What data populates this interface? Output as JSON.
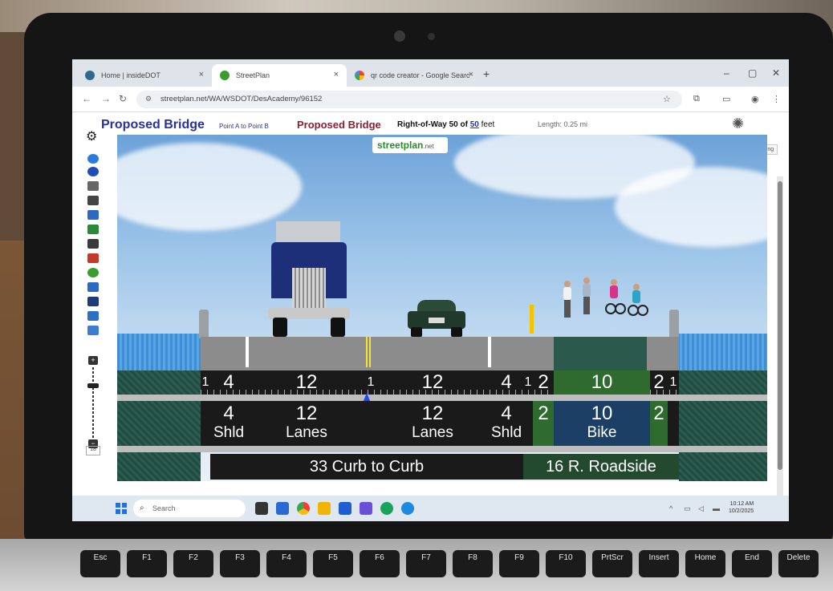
{
  "browser": {
    "tabs": [
      {
        "label": "Home | insideDOT"
      },
      {
        "label": "StreetPlan"
      },
      {
        "label": "qr code creator - Google Searc"
      }
    ],
    "url": "streetplan.net/WA/WSDOT/DesAcademy/96152"
  },
  "header": {
    "title": "Proposed Bridge",
    "subtitle": "Point A to Point B",
    "title2": "Proposed Bridge",
    "row_label": "Right-of-Way 50 of",
    "row_link": "50",
    "row_unit": "feet",
    "length": "Length: 0.25 mi",
    "tooltip": "Right Building"
  },
  "logo": {
    "main": "streetplan",
    "suffix": ".net"
  },
  "zoom": {
    "level": "18"
  },
  "widths": [
    "1",
    "4",
    "12",
    "1",
    "12",
    "4",
    "1",
    "2",
    "10",
    "2",
    "1"
  ],
  "labels": [
    {
      "n": "4",
      "t": "Shld"
    },
    {
      "n": "12",
      "t": "Lanes"
    },
    {
      "n": "12",
      "t": "Lanes"
    },
    {
      "n": "4",
      "t": "Shld"
    },
    {
      "n": "2",
      "t": ""
    },
    {
      "n": "10",
      "t": "Bike"
    },
    {
      "n": "2",
      "t": ""
    }
  ],
  "totals": {
    "curb": "33 Curb to Curb",
    "roadside": "16 R. Roadside"
  },
  "controls": {
    "left_count": "1"
  },
  "taskbar": {
    "search_placeholder": "Search",
    "time": "10:12 AM",
    "date": "10/2/2025"
  },
  "keyboard": {
    "keys": [
      "Esc",
      "F1",
      "F2",
      "F3",
      "F4",
      "F5",
      "F6",
      "F7",
      "F8",
      "F9",
      "F10",
      "PrtScr",
      "Insert",
      "Home",
      "End",
      "Delete"
    ]
  },
  "colors": {
    "title": "#28329c",
    "title2": "#8e1e33",
    "bike_lane": "#1c3f66",
    "buffer": "#2f6b2f"
  }
}
